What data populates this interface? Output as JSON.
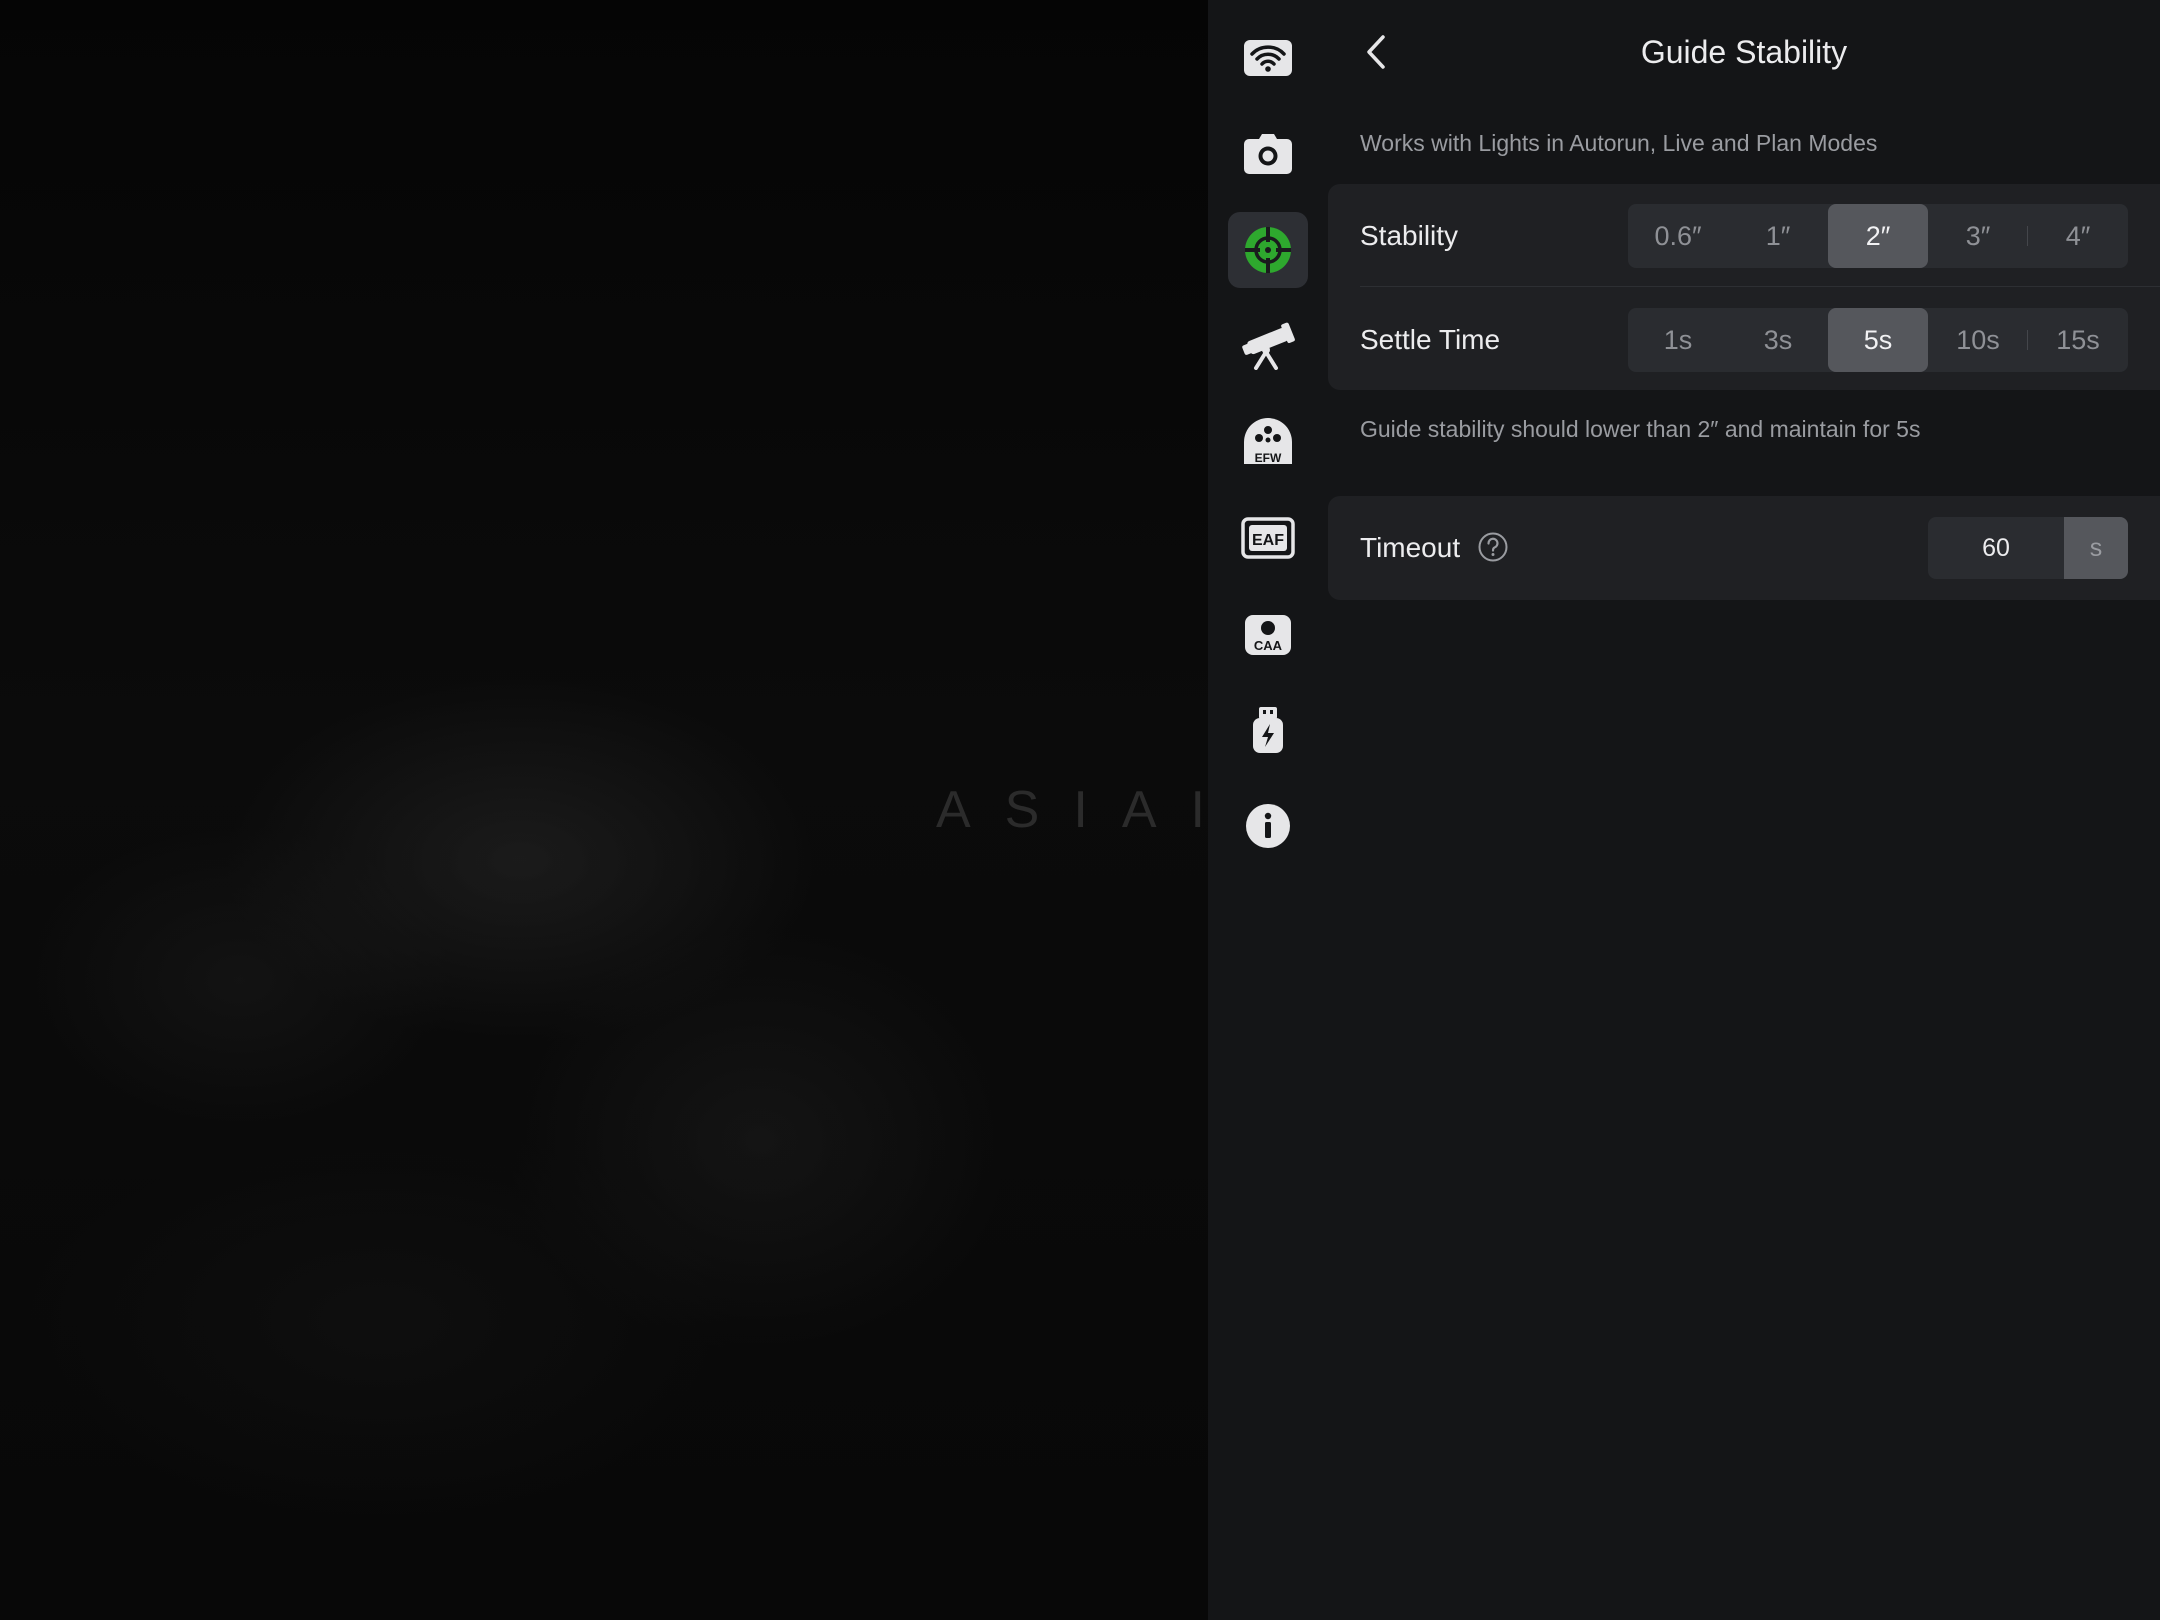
{
  "background": {
    "watermark": "ASIAIR"
  },
  "nav": {
    "items": [
      {
        "icon": "wifi-icon",
        "active": false
      },
      {
        "icon": "camera-icon",
        "active": false
      },
      {
        "icon": "guide-crosshair-icon",
        "active": true
      },
      {
        "icon": "telescope-icon",
        "active": false
      },
      {
        "icon": "efw-filter-wheel-icon",
        "label": "EFW",
        "active": false
      },
      {
        "icon": "eaf-focuser-icon",
        "label": "EAF",
        "active": false
      },
      {
        "icon": "caa-rotator-icon",
        "label": "CAA",
        "active": false
      },
      {
        "icon": "usb-power-icon",
        "active": false
      },
      {
        "icon": "info-icon",
        "active": false
      }
    ]
  },
  "header": {
    "title": "Guide Stability",
    "back_icon": "chevron-left-icon"
  },
  "intro": "Works with Lights in Autorun, Live and Plan Modes",
  "stability": {
    "label": "Stability",
    "options": [
      "0.6″",
      "1″",
      "2″",
      "3″",
      "4″"
    ],
    "selected": "2″"
  },
  "settle_time": {
    "label": "Settle Time",
    "options": [
      "1s",
      "3s",
      "5s",
      "10s",
      "15s"
    ],
    "selected": "5s"
  },
  "summary": "Guide stability should lower than 2″ and maintain for 5s",
  "timeout": {
    "label": "Timeout",
    "help_icon": "question-circle-icon",
    "value": "60",
    "unit": "s"
  },
  "colors": {
    "accent_green": "#2ea82e",
    "panel_bg": "#141517",
    "card_bg": "#1f2023",
    "segment_bg": "#2a2c30",
    "segment_active": "#55575c"
  }
}
